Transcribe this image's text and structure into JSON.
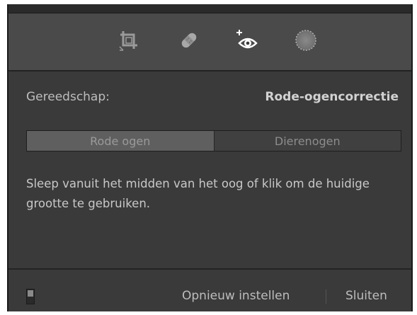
{
  "toolbar": {
    "tools": [
      {
        "icon": "crop-icon"
      },
      {
        "icon": "healing-brush-icon"
      },
      {
        "icon": "red-eye-correction-icon"
      },
      {
        "icon": "radial-mask-icon"
      }
    ]
  },
  "panel": {
    "tool_label": "Gereedschap:",
    "tool_value": "Rode-ogencorrectie",
    "modes": [
      "Rode ogen",
      "Dierenogen"
    ],
    "active_mode": "Rode ogen",
    "hint": "Sleep vanuit het midden van het oog of klik om de huidige grootte te gebruiken."
  },
  "footer": {
    "reset_label": "Opnieuw instellen",
    "close_label": "Sluiten"
  }
}
